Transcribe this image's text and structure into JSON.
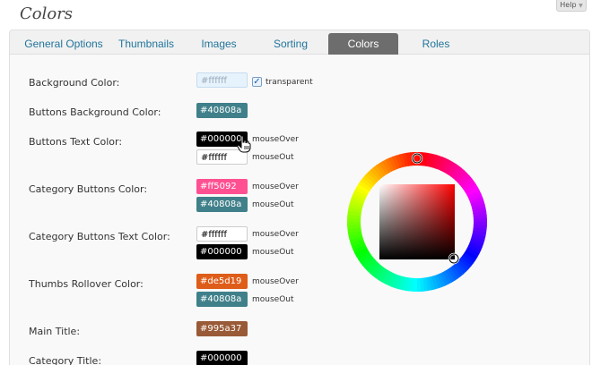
{
  "help": {
    "label": "Help"
  },
  "page": {
    "title": "Colors"
  },
  "tabs": [
    {
      "label": "General Options"
    },
    {
      "label": "Thumbnails"
    },
    {
      "label": "Images"
    },
    {
      "label": "Sorting"
    },
    {
      "label": "Colors"
    },
    {
      "label": "Roles"
    }
  ],
  "active_tab": "Colors",
  "settings": {
    "background": {
      "label": "Background Color:",
      "value": "#ffffff",
      "transparent_label": "transparent",
      "transparent_checked": true
    },
    "buttons_bg": {
      "label": "Buttons Background Color:",
      "value": "#40808a"
    },
    "buttons_text": {
      "label": "Buttons Text Color:",
      "over": "#000000",
      "over_label": "mouseOver",
      "out": "#ffffff",
      "out_label": "mouseOut"
    },
    "category_buttons": {
      "label": "Category Buttons Color:",
      "over": "#ff5092",
      "over_label": "mouseOver",
      "out": "#40808a",
      "out_label": "mouseOut"
    },
    "category_buttons_text": {
      "label": "Category Buttons Text Color:",
      "over": "#ffffff",
      "over_label": "mouseOver",
      "out": "#000000",
      "out_label": "mouseOut"
    },
    "thumbs_rollover": {
      "label": "Thumbs Rollover Color:",
      "over": "#de5d19",
      "over_label": "mouseOver",
      "out": "#40808a",
      "out_label": "mouseOut"
    },
    "main_title": {
      "label": "Main Title:",
      "value": "#995a37"
    },
    "category_title": {
      "label": "Category Title:",
      "value": "#000000"
    }
  },
  "colors": {
    "accent": "#21759b",
    "active_tab_bg": "#6d6d6d",
    "picker_selected": "#ff0000"
  },
  "icons": {
    "cursor": "hand-pointer-icon",
    "picker": "color-wheel-icon"
  }
}
